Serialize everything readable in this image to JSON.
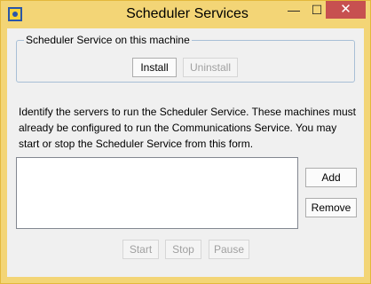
{
  "window": {
    "title": "Scheduler Services",
    "controls": {
      "minimize": "—",
      "maximize": "☐",
      "close": "✕"
    }
  },
  "service_group": {
    "legend": "Scheduler Service on this machine",
    "install_label": "Install",
    "uninstall_label": "Uninstall"
  },
  "description": "Identify the servers to run the Scheduler Service. These machines must already be configured to run the Communications Service. You may start or stop the Scheduler Service from this form.",
  "server_list": {
    "items": []
  },
  "list_actions": {
    "add_label": "Add",
    "remove_label": "Remove"
  },
  "service_actions": {
    "start_label": "Start",
    "stop_label": "Stop",
    "pause_label": "Pause"
  },
  "colors": {
    "title_bar": "#f3d576",
    "close_button": "#c75050",
    "client_background": "#f0f0f0"
  },
  "icons": {
    "app_icon": "scheduler-app-icon"
  }
}
